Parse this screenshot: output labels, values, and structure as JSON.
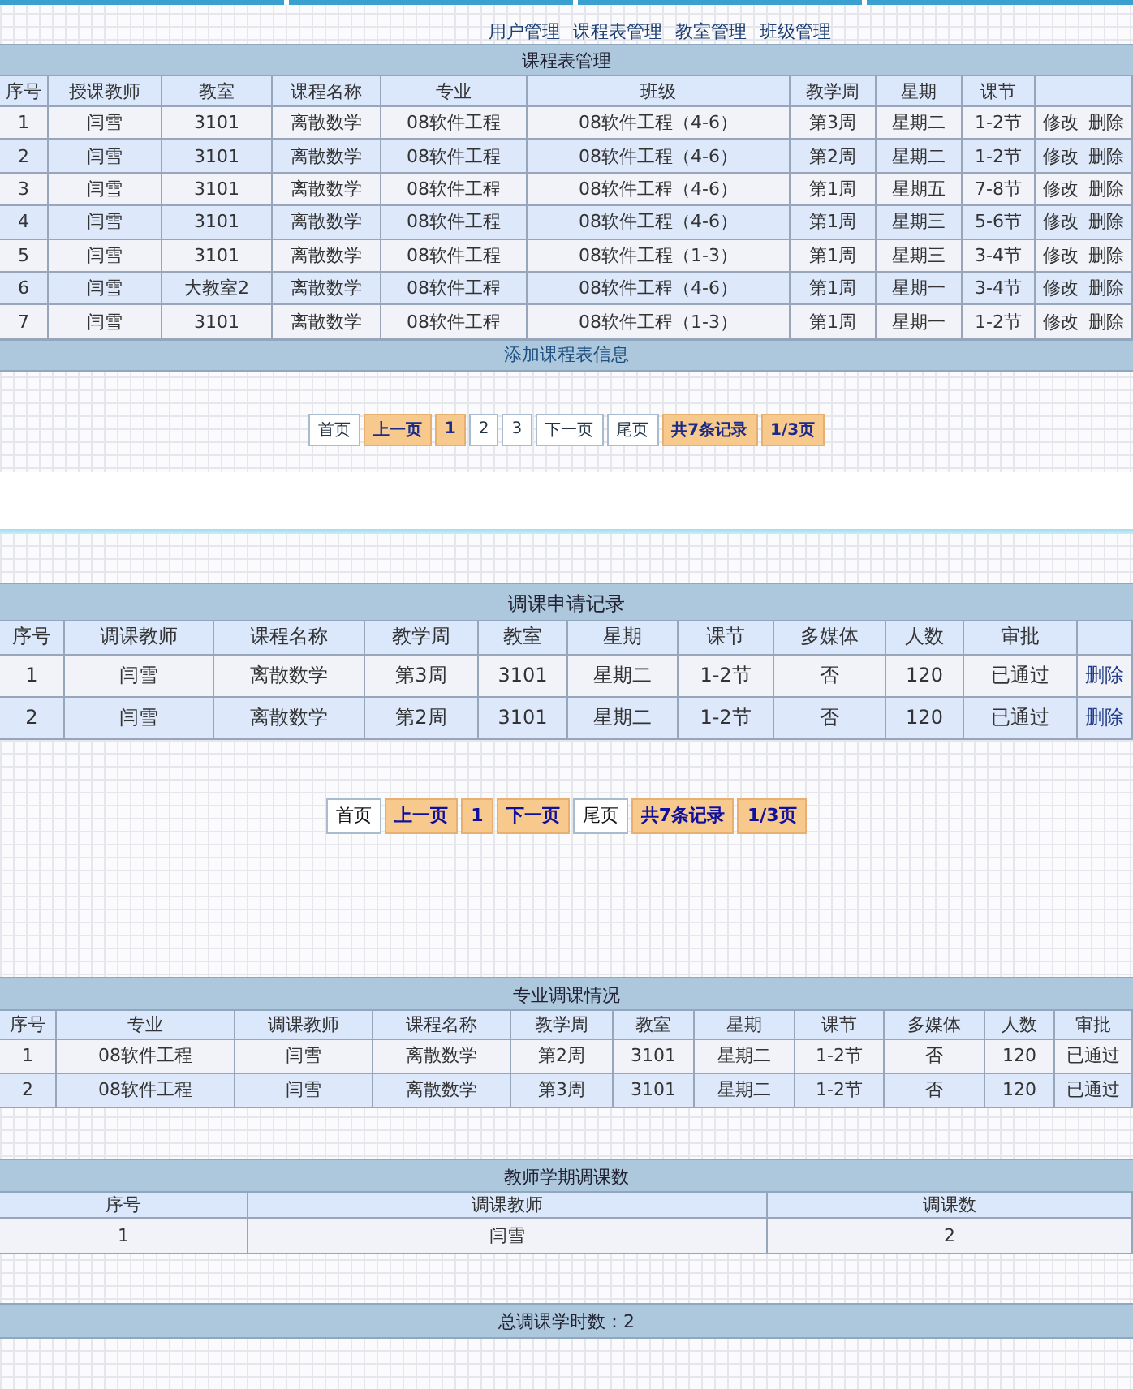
{
  "nav": [
    "用户管理",
    "课程表管理",
    "教室管理",
    "班级管理"
  ],
  "sections": [
    {
      "kind": "table",
      "title": "课程表管理",
      "columns": [
        "序号",
        "授课教师",
        "教室",
        "课程名称",
        "专业",
        "班级",
        "教学周",
        "星期",
        "课节"
      ],
      "rows": [
        {
          "cells": [
            "1",
            "闫雪",
            "3101",
            "离散数学",
            "08软件工程",
            "08软件工程（4-6）",
            "第3周",
            "星期二",
            "1-2节"
          ],
          "actions": [
            "修改",
            "删除"
          ]
        },
        {
          "cells": [
            "2",
            "闫雪",
            "3101",
            "离散数学",
            "08软件工程",
            "08软件工程（4-6）",
            "第2周",
            "星期二",
            "1-2节"
          ],
          "actions": [
            "修改",
            "删除"
          ]
        },
        {
          "cells": [
            "3",
            "闫雪",
            "3101",
            "离散数学",
            "08软件工程",
            "08软件工程（4-6）",
            "第1周",
            "星期五",
            "7-8节"
          ],
          "actions": [
            "修改",
            "删除"
          ]
        },
        {
          "cells": [
            "4",
            "闫雪",
            "3101",
            "离散数学",
            "08软件工程",
            "08软件工程（4-6）",
            "第1周",
            "星期三",
            "5-6节"
          ],
          "actions": [
            "修改",
            "删除"
          ]
        },
        {
          "cells": [
            "5",
            "闫雪",
            "3101",
            "离散数学",
            "08软件工程",
            "08软件工程（1-3）",
            "第1周",
            "星期三",
            "3-4节"
          ],
          "actions": [
            "修改",
            "删除"
          ]
        },
        {
          "cells": [
            "6",
            "闫雪",
            "大教室2",
            "离散数学",
            "08软件工程",
            "08软件工程（4-6）",
            "第1周",
            "星期一",
            "3-4节"
          ],
          "actions": [
            "修改",
            "删除"
          ]
        },
        {
          "cells": [
            "7",
            "闫雪",
            "3101",
            "离散数学",
            "08软件工程",
            "08软件工程（1-3）",
            "第1周",
            "星期一",
            "1-2节"
          ],
          "actions": [
            "修改",
            "删除"
          ]
        }
      ],
      "footer_link": "添加课程表信息",
      "pager": [
        {
          "label": "首页",
          "highlighted": false
        },
        {
          "label": "上一页",
          "highlighted": true
        },
        {
          "label": "1",
          "highlighted": true
        },
        {
          "label": "2",
          "highlighted": false
        },
        {
          "label": "3",
          "highlighted": false
        },
        {
          "label": "下一页",
          "highlighted": false
        },
        {
          "label": "尾页",
          "highlighted": false
        },
        {
          "label": "共7条记录",
          "highlighted": true
        },
        {
          "label": "1/3页",
          "highlighted": true
        }
      ]
    },
    {
      "kind": "table",
      "title": "调课申请记录",
      "columns": [
        "序号",
        "调课教师",
        "课程名称",
        "教学周",
        "教室",
        "星期",
        "课节",
        "多媒体",
        "人数",
        "审批"
      ],
      "rows": [
        {
          "cells": [
            "1",
            "闫雪",
            "离散数学",
            "第3周",
            "3101",
            "星期二",
            "1-2节",
            "否",
            "120",
            "已通过"
          ],
          "actions": [
            "删除"
          ]
        },
        {
          "cells": [
            "2",
            "闫雪",
            "离散数学",
            "第2周",
            "3101",
            "星期二",
            "1-2节",
            "否",
            "120",
            "已通过"
          ],
          "actions": [
            "删除"
          ]
        }
      ],
      "pager": [
        {
          "label": "首页",
          "highlighted": false
        },
        {
          "label": "上一页",
          "highlighted": true
        },
        {
          "label": "1",
          "highlighted": true
        },
        {
          "label": "下一页",
          "highlighted": true
        },
        {
          "label": "尾页",
          "highlighted": false
        },
        {
          "label": "共7条记录",
          "highlighted": true
        },
        {
          "label": "1/3页",
          "highlighted": true
        }
      ]
    },
    {
      "kind": "table",
      "title": "专业调课情况",
      "columns": [
        "序号",
        "专业",
        "调课教师",
        "课程名称",
        "教学周",
        "教室",
        "星期",
        "课节",
        "多媒体",
        "人数",
        "审批"
      ],
      "rows": [
        {
          "cells": [
            "1",
            "08软件工程",
            "闫雪",
            "离散数学",
            "第2周",
            "3101",
            "星期二",
            "1-2节",
            "否",
            "120",
            "已通过"
          ]
        },
        {
          "cells": [
            "2",
            "08软件工程",
            "闫雪",
            "离散数学",
            "第3周",
            "3101",
            "星期二",
            "1-2节",
            "否",
            "120",
            "已通过"
          ]
        }
      ]
    },
    {
      "kind": "table",
      "title": "教师学期调课数",
      "columns": [
        "序号",
        "调课教师",
        "调课数"
      ],
      "rows": [
        {
          "cells": [
            "1",
            "闫雪",
            "2"
          ]
        }
      ]
    },
    {
      "kind": "summary",
      "text": "总调课学时数：2"
    }
  ]
}
